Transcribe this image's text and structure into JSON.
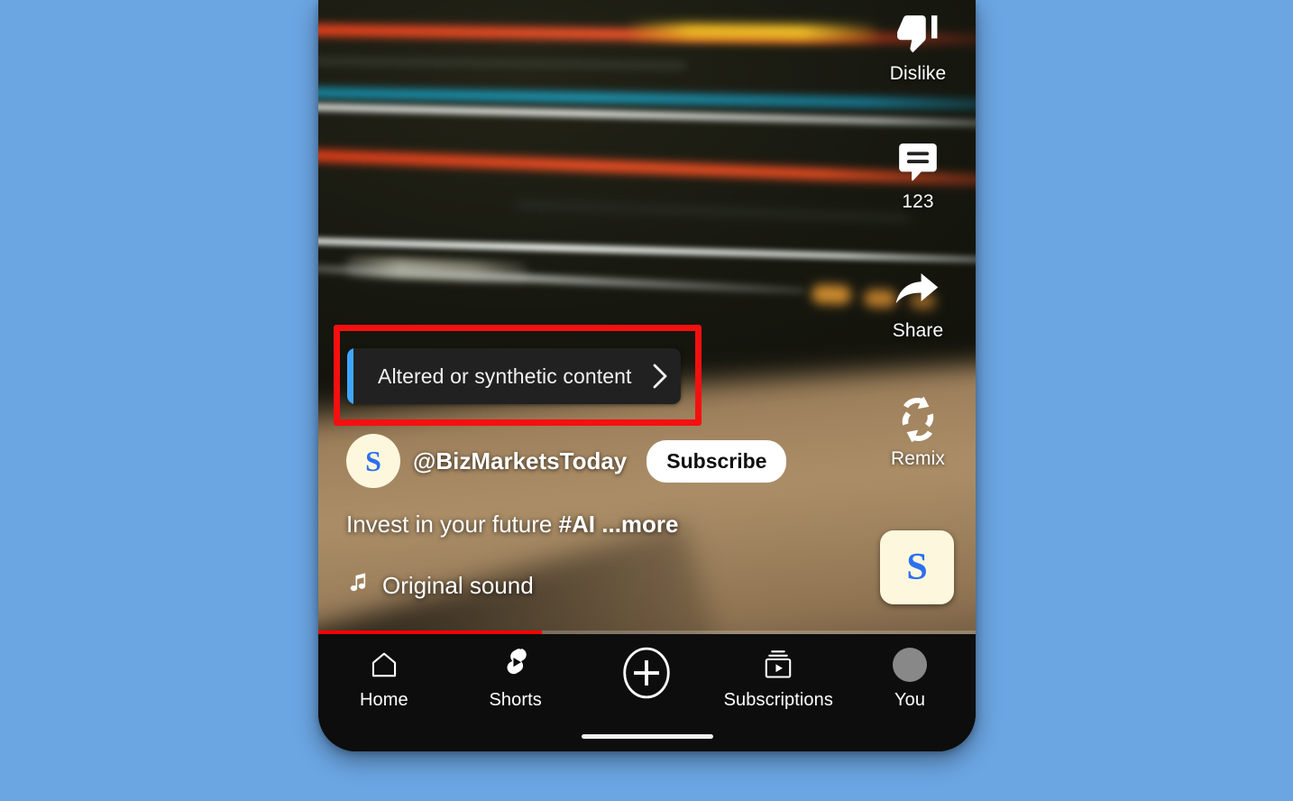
{
  "app": {
    "name": "YouTube Shorts",
    "background_color": "#6ba5e2",
    "accent_red": "#ff0000",
    "highlight_color": "#f41010",
    "disclosure_accent": "#3ea6ff"
  },
  "video": {
    "progress_percent": 34,
    "caption_text": "Invest in your future ",
    "caption_hashtag": "#AI",
    "caption_more": "...more",
    "sound_label": "Original sound",
    "sound_icon": "music-note-icon",
    "sound_thumbnail_letter": "S"
  },
  "disclosure_banner": {
    "label": "Altered or synthetic content",
    "chevron_icon": "chevron-right-icon",
    "accent_color": "#3ea6ff"
  },
  "channel": {
    "avatar_letter": "S",
    "handle": "@BizMarketsToday",
    "subscribe_label": "Subscribe"
  },
  "action_rail": [
    {
      "id": "dislike",
      "icon": "thumbs-down-icon",
      "label": "Dislike"
    },
    {
      "id": "comments",
      "icon": "comment-bubble-icon",
      "label": "123"
    },
    {
      "id": "share",
      "icon": "share-arrow-icon",
      "label": "Share"
    },
    {
      "id": "remix",
      "icon": "remix-arrows-icon",
      "label": "Remix"
    }
  ],
  "bottom_nav": [
    {
      "id": "home",
      "icon": "home-icon",
      "label": "Home"
    },
    {
      "id": "shorts",
      "icon": "shorts-icon",
      "label": "Shorts"
    },
    {
      "id": "create",
      "icon": "plus-circle-icon",
      "label": ""
    },
    {
      "id": "subscriptions",
      "icon": "subscriptions-icon",
      "label": "Subscriptions"
    },
    {
      "id": "you",
      "icon": "account-avatar-icon",
      "label": "You"
    }
  ]
}
